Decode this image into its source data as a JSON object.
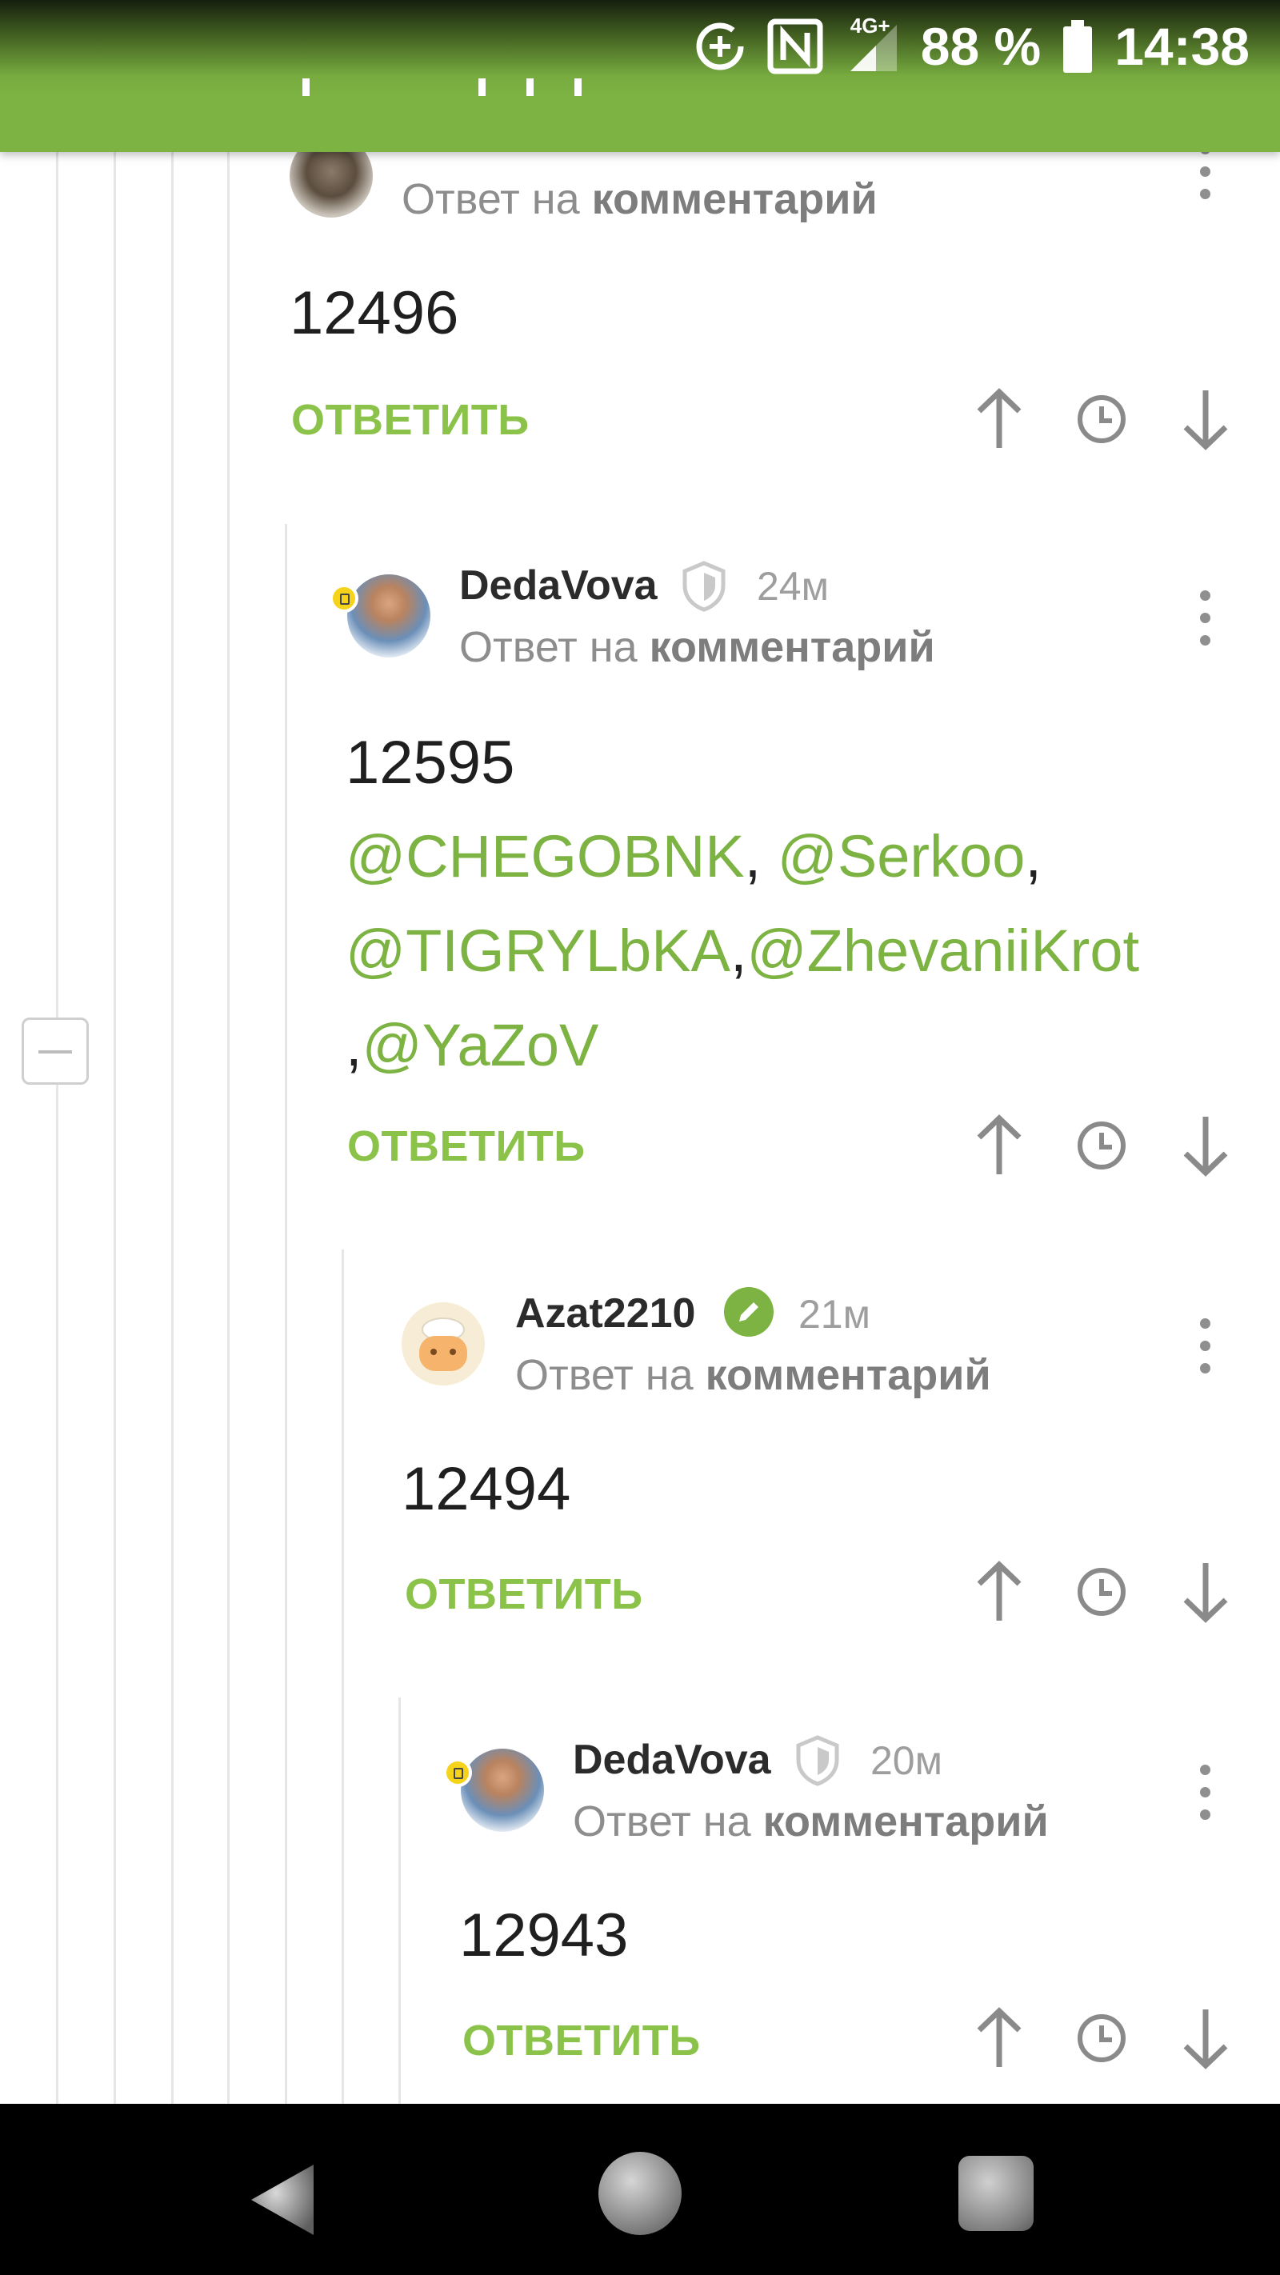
{
  "status_bar": {
    "network": "4G+",
    "battery": "88 %",
    "time": "14:38",
    "icons": [
      "data-saver-icon",
      "nfc-icon",
      "signal-icon",
      "battery-icon"
    ]
  },
  "colors": {
    "accent": "#7cb342",
    "reply": "#8bc34a",
    "muted": "#9e9e9e"
  },
  "comments": [
    {
      "avatar": "bird-avatar",
      "reply_to_prefix": "Ответ на",
      "reply_to_target": "комментарий",
      "body": "12496",
      "reply_label": "ОТВЕТИТЬ"
    },
    {
      "username": "DedaVova",
      "badge": "shield-icon",
      "time": "24м",
      "reply_to_prefix": "Ответ на",
      "reply_to_target": "комментарий",
      "body": "12595",
      "mentions": [
        "@CHEGOBNK",
        "@Serkoo",
        "@TIGRYLbKA",
        "@ZhevaniiKrot",
        "@YaZoV"
      ],
      "separators": [
        ", ",
        ",",
        ",",
        ","
      ],
      "reply_label": "ОТВЕТИТЬ"
    },
    {
      "username": "Azat2210",
      "badge": "pencil-icon",
      "time": "21м",
      "reply_to_prefix": "Ответ на",
      "reply_to_target": "комментарий",
      "body": "12494",
      "reply_label": "ОТВЕТИТЬ"
    },
    {
      "username": "DedaVova",
      "badge": "shield-icon",
      "time": "20м",
      "reply_to_prefix": "Ответ на",
      "reply_to_target": "комментарий",
      "body": "12943",
      "reply_label": "ОТВЕТИТЬ"
    }
  ]
}
